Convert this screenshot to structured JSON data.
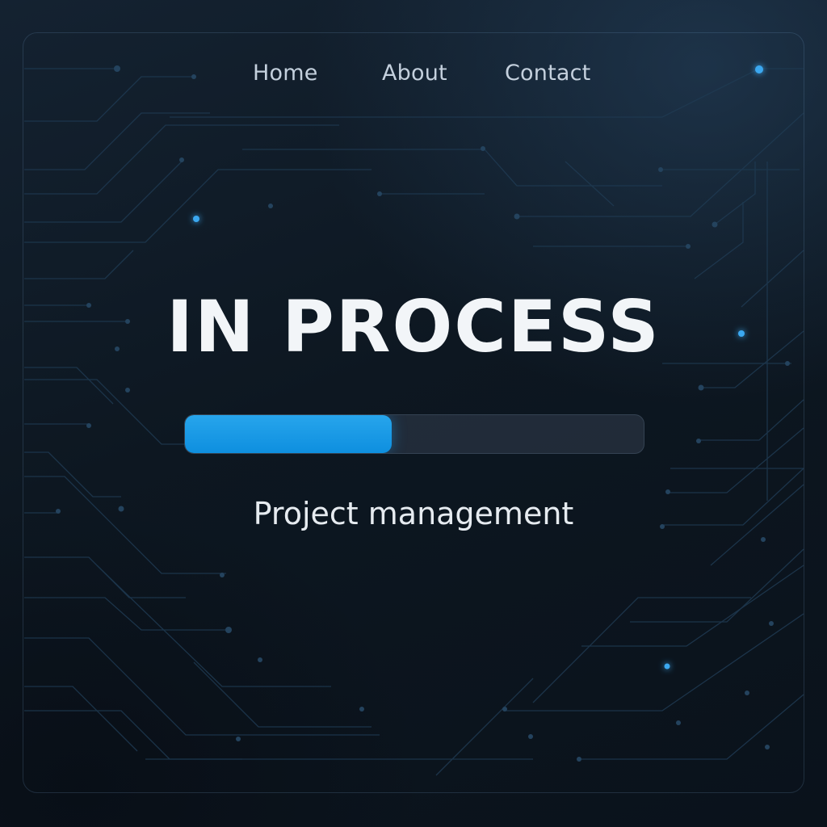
{
  "nav": {
    "items": [
      {
        "label": "Home"
      },
      {
        "label": "About"
      },
      {
        "label": "Contact"
      }
    ]
  },
  "main": {
    "status_title": "IN PROCESS",
    "progress_percent": 45,
    "subtitle": "Project management"
  },
  "theme": {
    "background": "#0d1721",
    "accent": "#1a9be6",
    "circuit_line": "#2a4d6b",
    "glow_dot": "#3aa8f0"
  }
}
